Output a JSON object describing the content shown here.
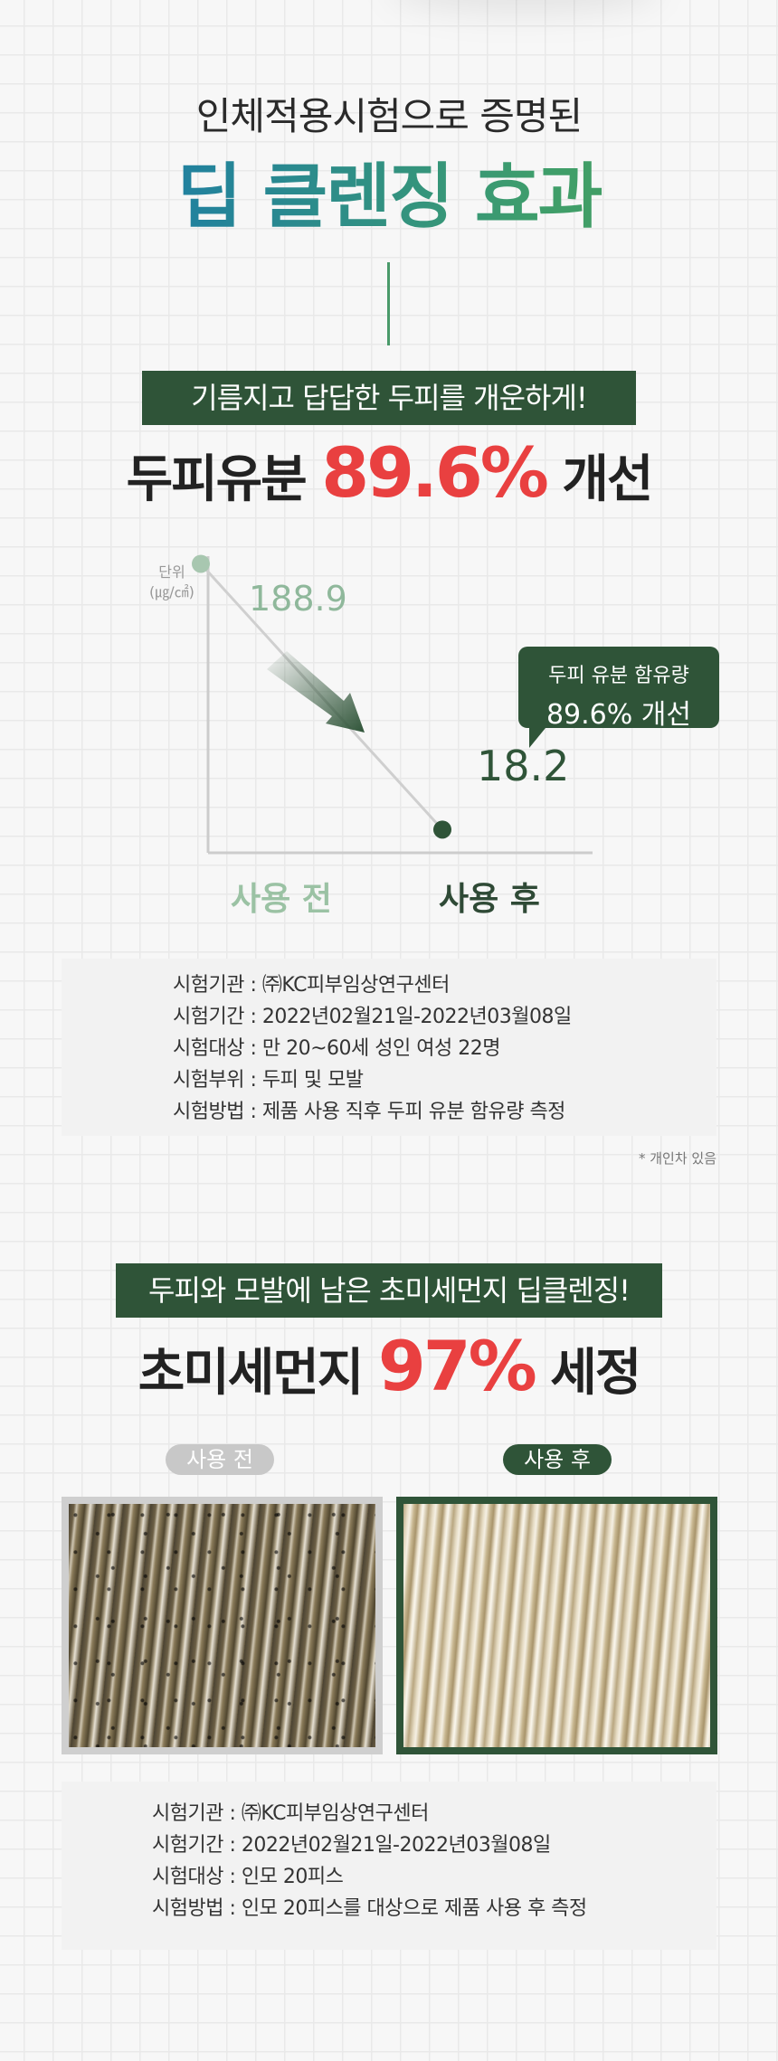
{
  "hero": {
    "subtitle": "인체적용시험으로 증명된",
    "title": "딥 클렌징 효과"
  },
  "section1": {
    "banner": "기름지고 답답한 두피를 개운하게!",
    "headline_pre": "두피유분",
    "headline_pct": "89.6%",
    "headline_post": "개선",
    "info": [
      "시험기관 : ㈜KC피부임상연구센터",
      "시험기간 : 2022년02월21일-2022년03월08일",
      "시험대상 : 만 20~60세 성인 여성 22명",
      "시험부위 : 두피 및 모발",
      "시험방법 : 제품 사용 직후 두피 유분 함유량 측정"
    ],
    "note": "* 개인차 있음"
  },
  "chart_data": {
    "type": "line",
    "categories": [
      "사용 전",
      "사용 후"
    ],
    "values": [
      188.9,
      18.2
    ],
    "value_labels": [
      "188.9",
      "18.2"
    ],
    "unit_line1": "단위",
    "unit_line2": "(㎍/㎠)",
    "callout_line1": "두피 유분 함유량",
    "callout_line2": "89.6% 개선",
    "grid": false,
    "colors": {
      "before": "#8fb89b",
      "after": "#2f5438",
      "line": "#cccccc"
    }
  },
  "section2": {
    "banner": "두피와 모발에 남은 초미세먼지 딥클렌징!",
    "headline_pre": "초미세먼지",
    "headline_pct": "97%",
    "headline_post": "세정",
    "label_before": "사용 전",
    "label_after": "사용 후",
    "info": [
      "시험기관 : ㈜KC피부임상연구센터",
      "시험기간 : 2022년02월21일-2022년03월08일",
      "시험대상 : 인모 20피스",
      "시험방법 : 인모 20피스를 대상으로 제품 사용 후 측정"
    ]
  },
  "colors": {
    "brand_green": "#2f5438",
    "accent_red": "#e94040",
    "title_gradient_start": "#1f7fa2",
    "title_gradient_end": "#4aa05a"
  }
}
